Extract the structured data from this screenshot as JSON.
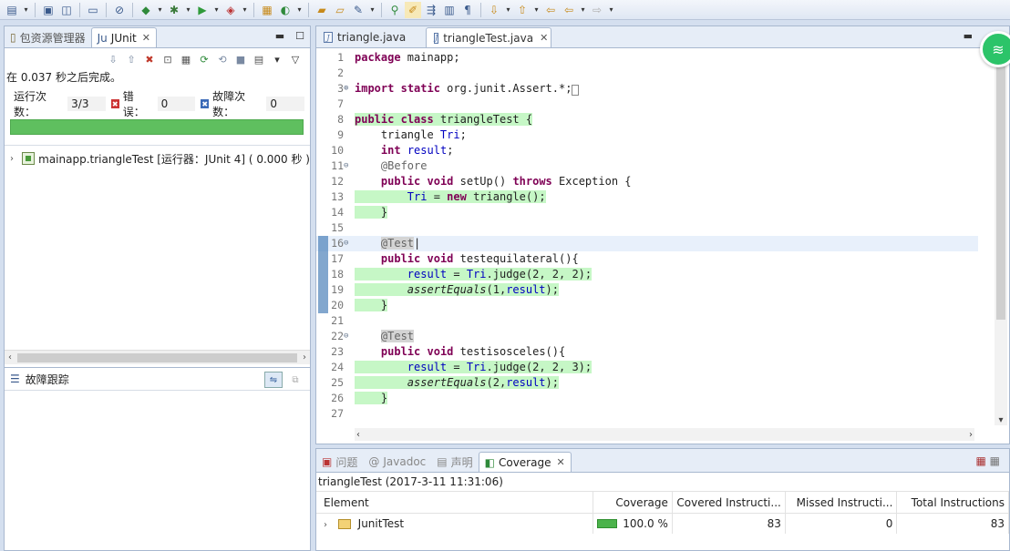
{
  "left_panel": {
    "tabs": [
      {
        "label": "包资源管理器",
        "icon": "package-explorer-icon"
      },
      {
        "label": "JUnit",
        "icon": "junit-icon"
      }
    ],
    "finished_text": "在 0.037 秒之后完成。",
    "runs_label": "运行次数：",
    "runs_value": "3/3",
    "errors_label": "错误：",
    "errors_value": "0",
    "failures_label": "故障次数：",
    "failures_value": "0",
    "progress_percent": 100,
    "progress_color": "#5fbf5f",
    "tree": [
      {
        "label": "mainapp.triangleTest [运行器：JUnit 4] ( 0.000 秒 )"
      }
    ],
    "failure_trace_label": "故障跟踪"
  },
  "editor": {
    "tabs": [
      {
        "label": "triangle.java"
      },
      {
        "label": "triangleTest.java"
      }
    ]
  },
  "coverage": {
    "tabs": [
      {
        "label": "问题"
      },
      {
        "label": "Javadoc"
      },
      {
        "label": "声明"
      },
      {
        "label": "Coverage"
      }
    ],
    "session": "triangleTest (2017-3-11 11:31:06)",
    "columns": [
      "Element",
      "Coverage",
      "Covered Instructi...",
      "Missed Instructi...",
      "Total Instructions"
    ],
    "rows": [
      {
        "element": "JunitTest",
        "coverage": "100.0 %",
        "covered": "83",
        "missed": "0",
        "total": "83"
      }
    ],
    "bar_color": "#4bb34b"
  }
}
